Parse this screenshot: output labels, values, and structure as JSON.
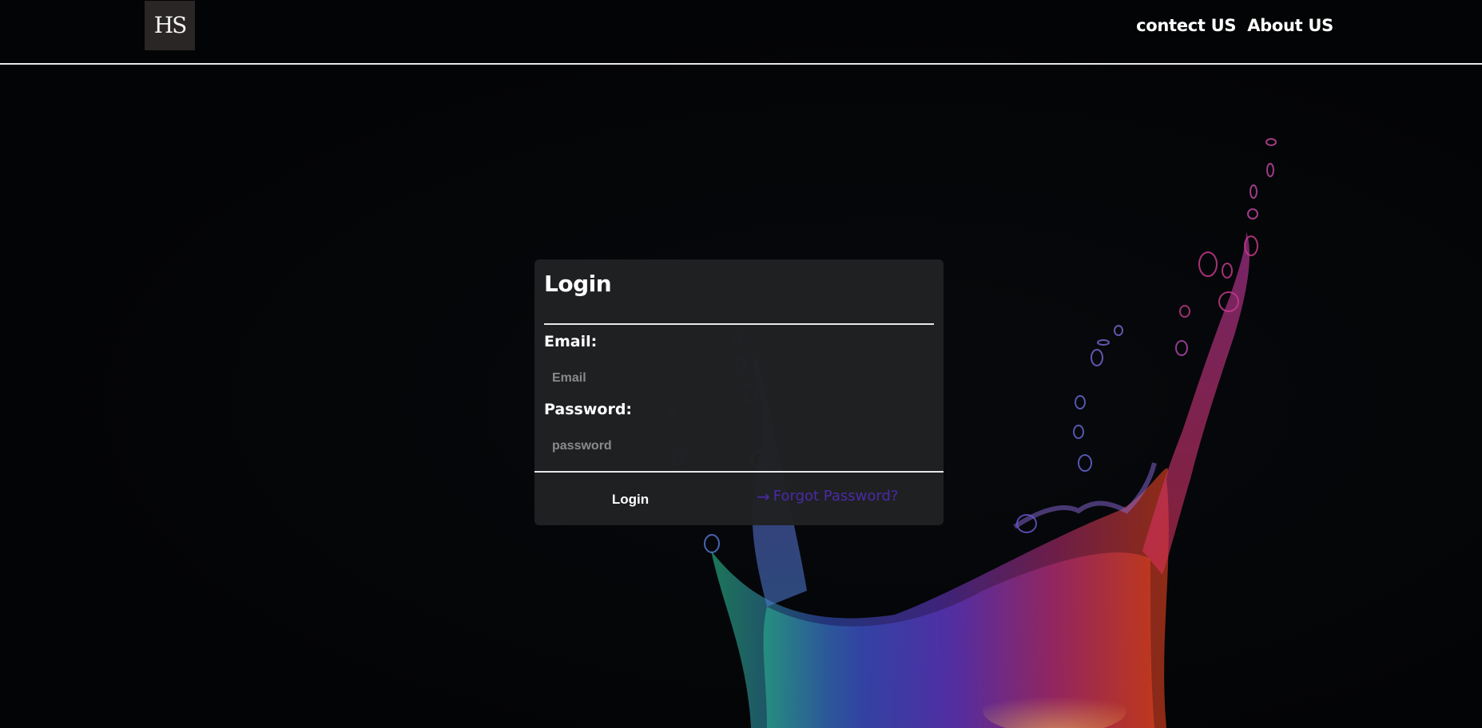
{
  "header": {
    "logo_text": "HS",
    "nav": [
      {
        "label": "contect US"
      },
      {
        "label": "About US"
      }
    ]
  },
  "login_card": {
    "title": "Login",
    "email_label": "Email:",
    "email_placeholder": "Email",
    "email_value": "",
    "password_label": "Password:",
    "password_placeholder": "password",
    "password_value": "",
    "login_button": "Login",
    "forgot_icon": "arrow-right-icon",
    "forgot_link": "Forgot Password?"
  },
  "colors": {
    "background": "#040507",
    "card": "#202123",
    "link": "#4b2aa5",
    "text": "#ffffff"
  }
}
